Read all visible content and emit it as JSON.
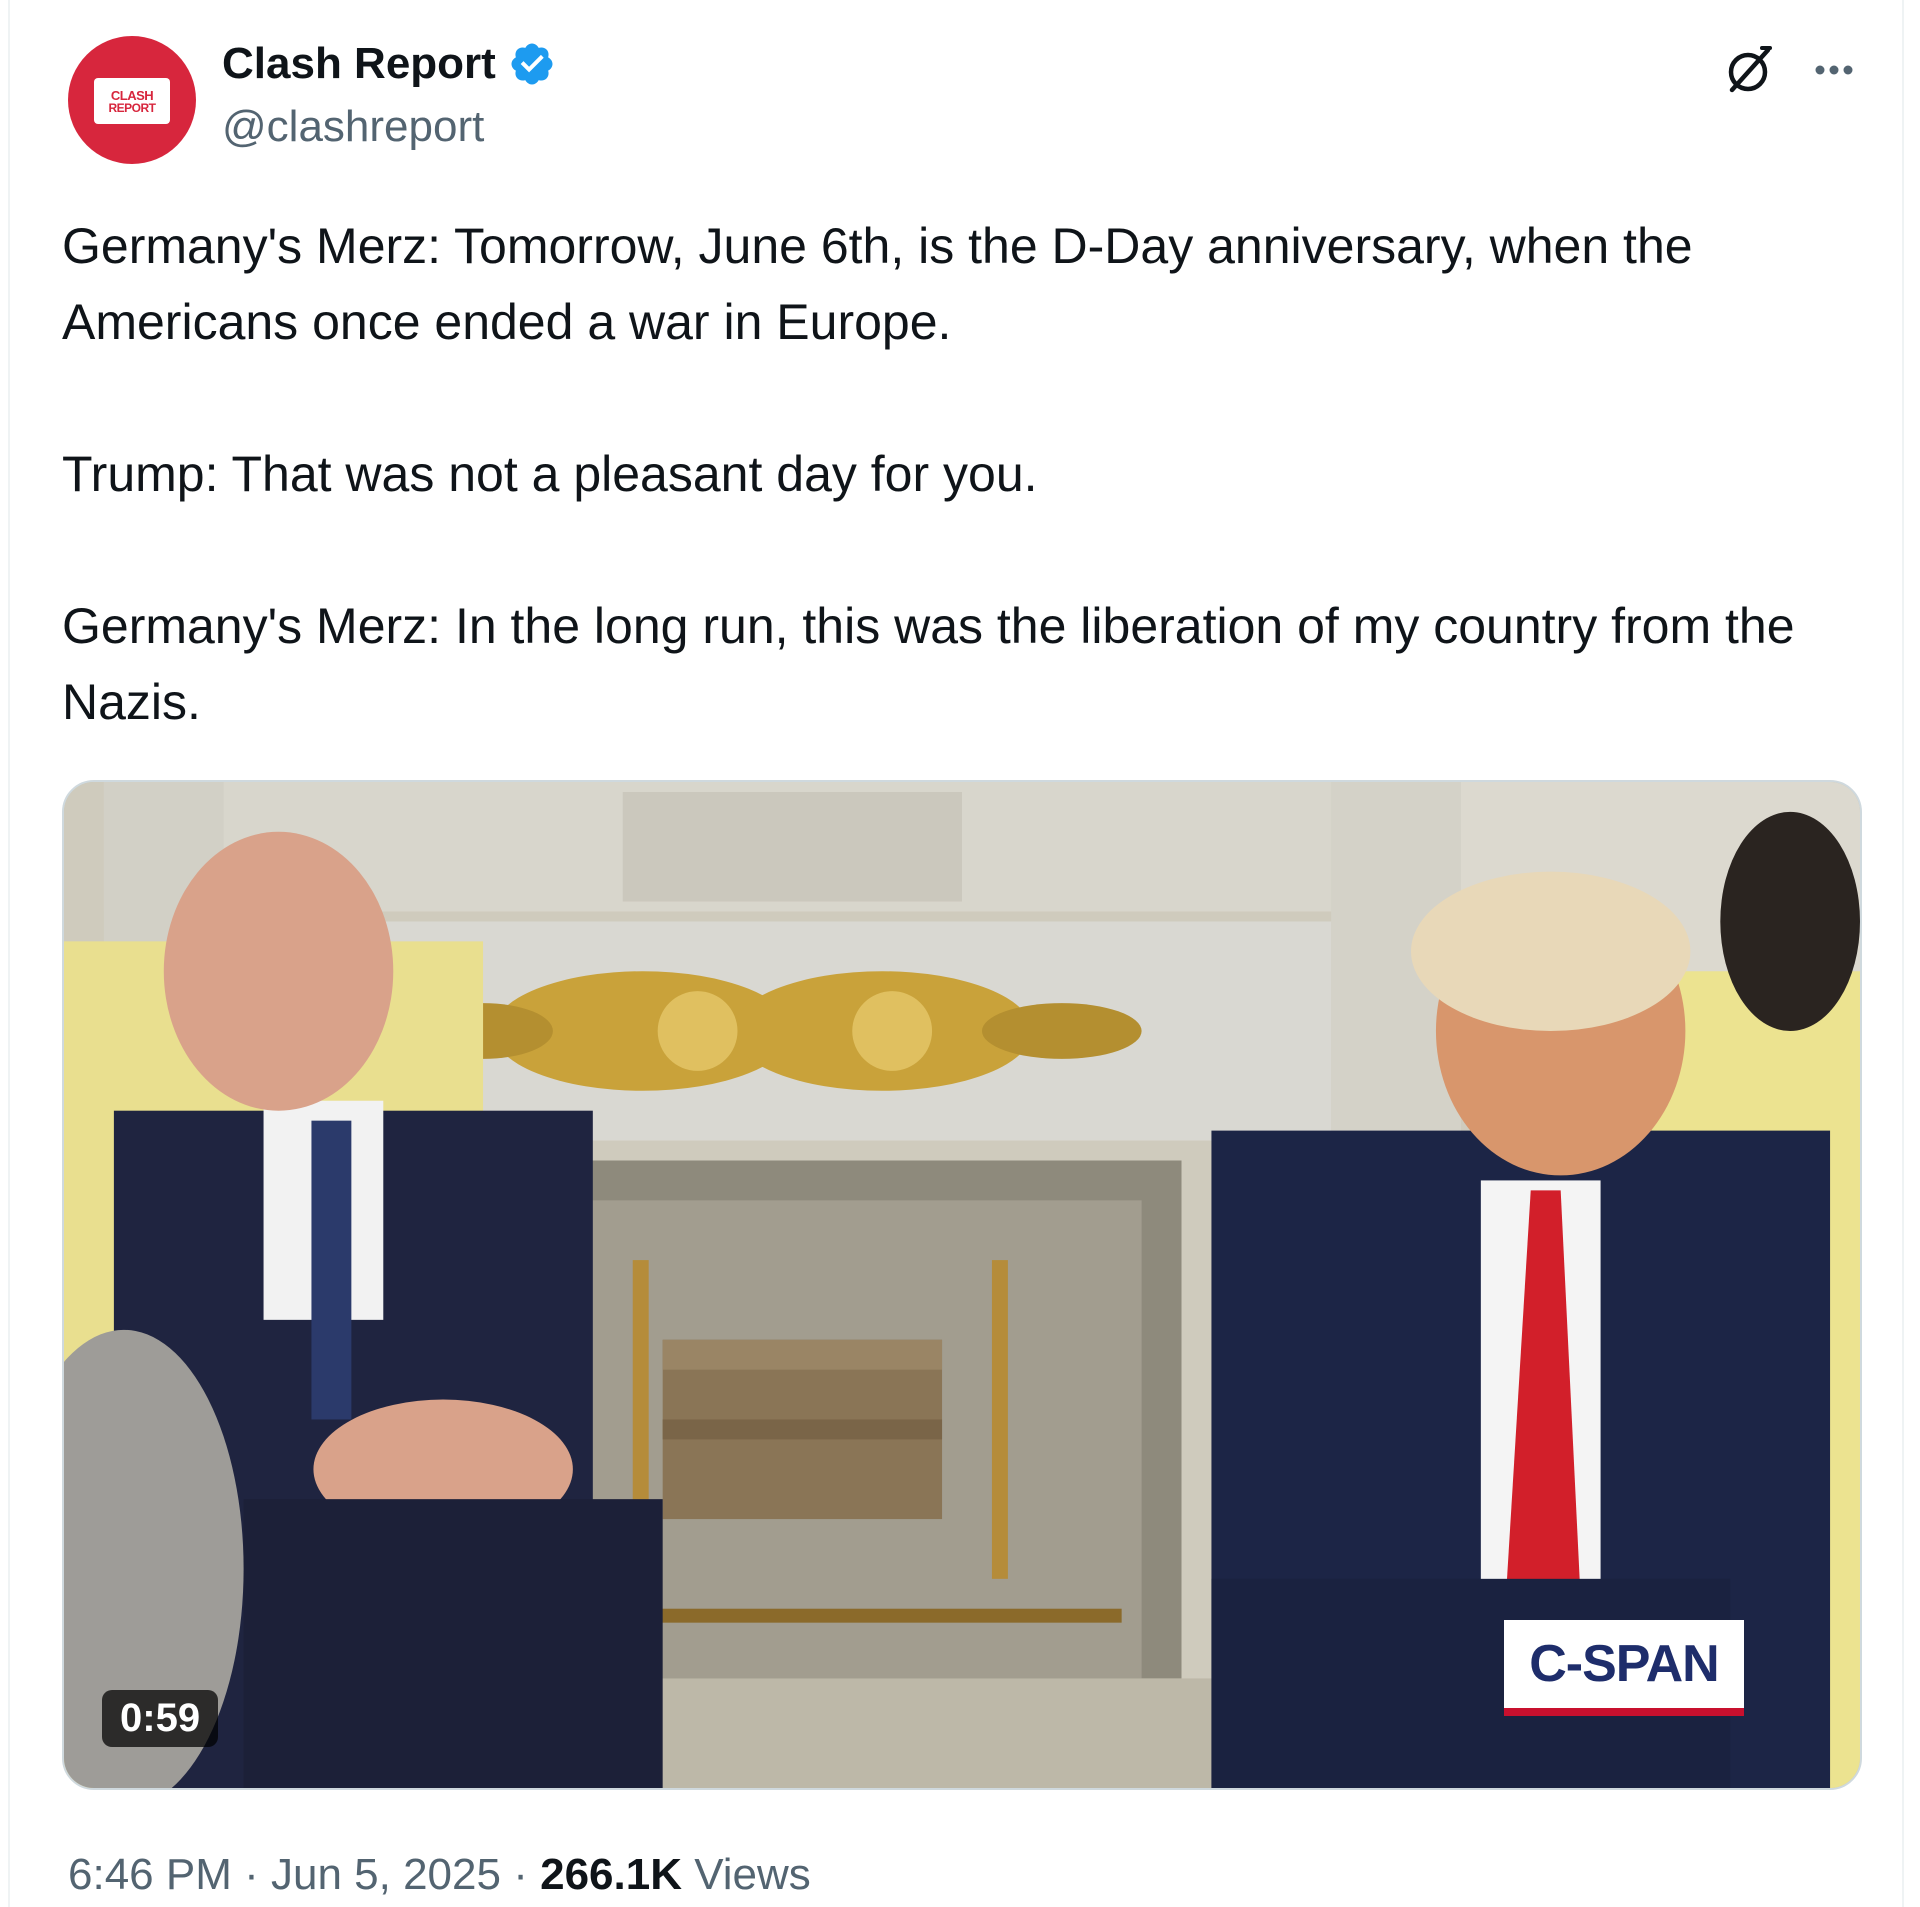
{
  "author": {
    "display_name": "Clash Report",
    "handle": "@clashreport",
    "avatar_text_line1": "CLASH",
    "avatar_text_line2": "REPORT",
    "verified": true,
    "brand_color": "#d7263d",
    "verified_color": "#1d9bf0"
  },
  "tweet": {
    "paragraphs": [
      "Germany's Merz: Tomorrow, June 6th, is the D-Day anniversary, when the Americans once ended a war in Europe.",
      "Trump: That was not a pleasant day for you.",
      "Germany's Merz: In the long run, this was the liberation of my country from the Nazis."
    ]
  },
  "media": {
    "type": "video",
    "duration": "0:59",
    "watermark": "C-SPAN"
  },
  "footer": {
    "time": "6:46 PM",
    "date": "Jun 5, 2025",
    "separator": "·",
    "views_count": "266.1K",
    "views_label": "Views"
  },
  "icons": {
    "grok": "grok-icon",
    "more": "more-icon",
    "verified": "verified-badge-icon"
  }
}
